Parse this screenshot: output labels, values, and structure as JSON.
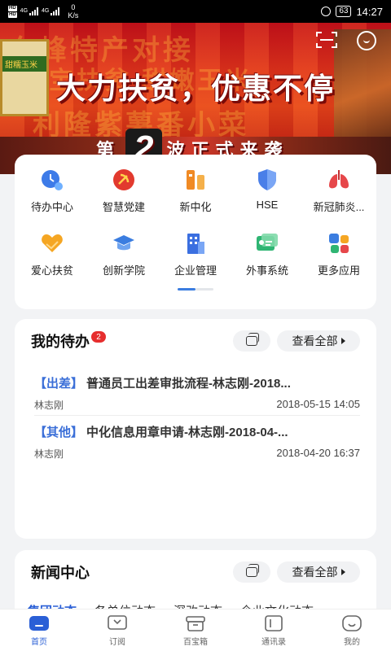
{
  "status_bar": {
    "sim_tags": [
      "HD",
      "HD"
    ],
    "network": "4G",
    "speed_value": "0",
    "speed_unit": "K/s",
    "battery": "63",
    "time": "14:27"
  },
  "banner": {
    "headline": "大力扶贫，优惠不停",
    "sub_prefix": "第",
    "sub_number": "2",
    "sub_suffix": "波正式来袭",
    "background_text_top": "东峰特产对接",
    "background_text_mid": "宝扶贫 甜嫩玉米",
    "background_text_low": "利隆紫薯番小菜",
    "product_label": "甜糯玉米"
  },
  "shortcuts": {
    "items": [
      {
        "label": "待办中心",
        "icon": "clock-icon",
        "color": "#3d7be8"
      },
      {
        "label": "智慧党建",
        "icon": "party-emblem-icon",
        "color": "#e23a2e"
      },
      {
        "label": "新中化",
        "icon": "bars-icon",
        "color": "#f08a24"
      },
      {
        "label": "HSE",
        "icon": "shield-icon",
        "color": "#4a7fe8"
      },
      {
        "label": "新冠肺炎...",
        "icon": "lungs-icon",
        "color": "#e6474a"
      },
      {
        "label": "爱心扶贫",
        "icon": "heart-hands-icon",
        "color": "#f5a623"
      },
      {
        "label": "创新学院",
        "icon": "graduation-cap-icon",
        "color": "#3b7de0"
      },
      {
        "label": "企业管理",
        "icon": "building-icon",
        "color": "#3b6fe0"
      },
      {
        "label": "外事系统",
        "icon": "id-card-icon",
        "color": "#2fb573"
      },
      {
        "label": "更多应用",
        "icon": "apps-icon",
        "color": "#3b7de0"
      }
    ],
    "page_indicator": {
      "pages": 2,
      "current": 1
    }
  },
  "todo": {
    "title": "我的待办",
    "badge": "2",
    "view_all": "查看全部",
    "items": [
      {
        "tag": "【出差】",
        "text": "普通员工出差审批流程-林志刚-2018...",
        "person": "林志刚",
        "time": "2018-05-15 14:05"
      },
      {
        "tag": "【其他】",
        "text": "中化信息用章申请-林志刚-2018-04-...",
        "person": "林志刚",
        "time": "2018-04-20 16:37"
      }
    ]
  },
  "news": {
    "title": "新闻中心",
    "view_all": "查看全部",
    "tabs": [
      "集团动态",
      "各单位动态",
      "深改动态",
      "企业文化动态"
    ]
  },
  "bottom_nav": {
    "items": [
      {
        "label": "首页",
        "icon": "home-icon",
        "active": true
      },
      {
        "label": "订阅",
        "icon": "subscribe-icon",
        "active": false
      },
      {
        "label": "百宝箱",
        "icon": "toolbox-icon",
        "active": false
      },
      {
        "label": "通讯录",
        "icon": "contacts-icon",
        "active": false
      },
      {
        "label": "我的",
        "icon": "profile-icon",
        "active": false
      }
    ]
  },
  "colors": {
    "accent": "#2a5fd6",
    "tag_blue": "#3b6fd8",
    "badge_red": "#e62e2e"
  }
}
